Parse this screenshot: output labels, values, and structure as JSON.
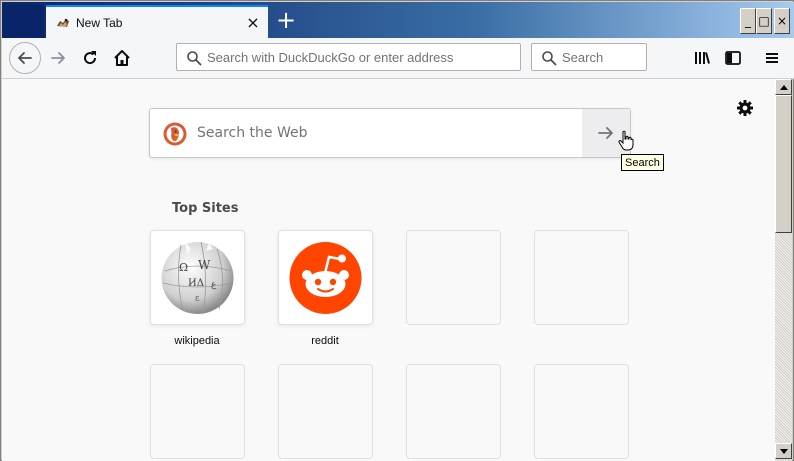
{
  "tab": {
    "title": "New Tab",
    "close_label": "×"
  },
  "new_tab_symbol": "+",
  "window_buttons": {
    "minimize": "_",
    "maximize": "□",
    "close": "×"
  },
  "toolbar": {
    "url_placeholder": "Search with DuckDuckGo or enter address",
    "search_placeholder": "Search",
    "icons": [
      "back-arrow-icon",
      "forward-arrow-icon",
      "reload-icon",
      "home-icon",
      "library-icon",
      "sidebar-icon",
      "hamburger-menu-icon"
    ]
  },
  "content": {
    "web_search_placeholder": "Search the Web",
    "search_button_tooltip": "Search",
    "top_sites_title": "Top Sites",
    "top_sites": [
      {
        "label": "wikipedia",
        "icon": "wikipedia-globe-icon"
      },
      {
        "label": "reddit",
        "icon": "reddit-alien-icon"
      }
    ]
  },
  "colors": {
    "accent": "#0a84ff",
    "reddit": "#ff4500",
    "duckduckgo": "#de5833",
    "titlebar_start": "#0a246a",
    "titlebar_end": "#a6caf0"
  }
}
